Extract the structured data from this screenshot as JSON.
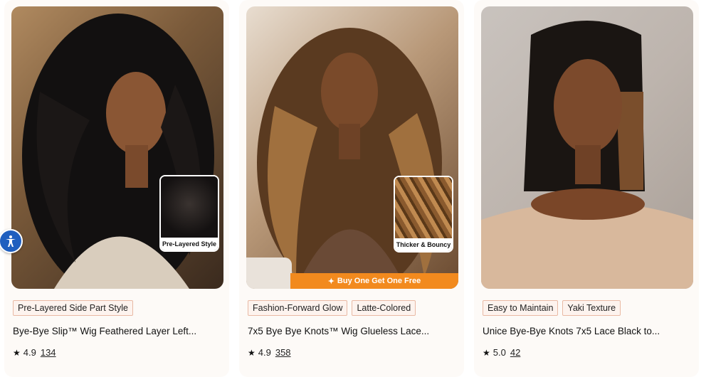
{
  "products": [
    {
      "inset_caption": "Pre-Layered Style",
      "tags": [
        "Pre-Layered Side Part Style"
      ],
      "title": "Bye-Bye Slip™ Wig Feathered Layer Left...",
      "rating": "4.9",
      "reviews": "134"
    },
    {
      "inset_caption": "Thicker & Bouncy",
      "promo": "Buy One Get One Free",
      "tags": [
        "Fashion-Forward Glow",
        "Latte-Colored"
      ],
      "title": "7x5 Bye Bye Knots™ Wig Glueless Lace...",
      "rating": "4.9",
      "reviews": "358"
    },
    {
      "tags": [
        "Easy to Maintain",
        "Yaki Texture"
      ],
      "title": "Unice Bye-Bye Knots 7x5 Lace Black to...",
      "rating": "5.0",
      "reviews": "42"
    }
  ],
  "icons": {
    "star": "star-icon",
    "accessibility": "accessibility-icon"
  },
  "colors": {
    "tag_border": "#e9b9a4",
    "tag_bg": "#fdf3ee",
    "promo_bar": "#f28a1e",
    "accessibility_button": "#1f5fbf"
  }
}
